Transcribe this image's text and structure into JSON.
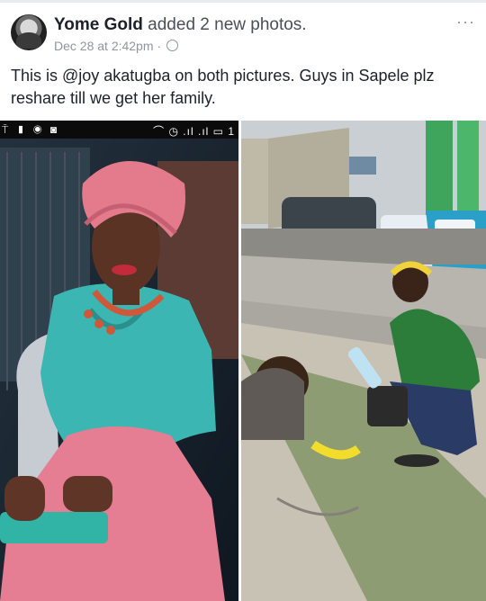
{
  "post": {
    "author": "Yome Gold",
    "action": "added 2 new photos.",
    "timestamp": "Dec 28 at 2:42pm",
    "separator": "·",
    "more_icon": "ellipsis-icon",
    "text": "This is @joy akatugba on both pictures. Guys in Sapele plz reshare till we get her family."
  },
  "photos": [
    {
      "id": "photo-left",
      "status_icons_left": "⍑ ▮ ◉ ◙",
      "status_icons_right": "⌒ ◷ .ıl .ıl ▭ 1"
    },
    {
      "id": "photo-right"
    }
  ]
}
